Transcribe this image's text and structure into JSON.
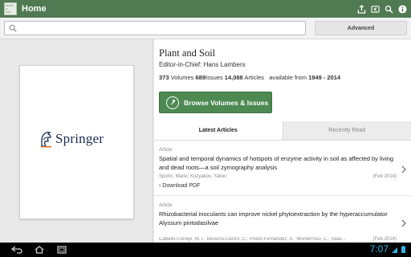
{
  "app": {
    "icon_lines": [
      "PLANT",
      "&",
      "SOIL"
    ],
    "title": "Home",
    "actions": [
      "share-icon",
      "back-icon",
      "search-icon",
      "info-icon"
    ]
  },
  "search": {
    "value": "",
    "placeholder": "",
    "advanced_label": "Advanced"
  },
  "cover": {
    "publisher": "Springer"
  },
  "journal": {
    "title": "Plant and Soil",
    "editor_label": "Editor-in-Chief:",
    "editor_name": "Hans Lambers",
    "volumes_count": "373",
    "volumes_label": "Volumes",
    "issues_count": "689",
    "issues_label": "Issues",
    "articles_count": "14,088",
    "articles_label": "Articles",
    "available_label": "available from",
    "year_range": "1949 - 2014",
    "browse_label": "Browse Volumes & Issues"
  },
  "tabs": [
    {
      "label": "Latest Articles",
      "active": true
    },
    {
      "label": "Recently Read",
      "active": false
    }
  ],
  "articles": [
    {
      "type": "Article",
      "title": "Spatial and temporal dynamics of hotspots of enzyme activity in soil as affected by living and dead roots—a soil zymography analysis",
      "authors": "Spohn, Marie; Kuzyakov, Yakov",
      "date": "(Feb 2014)",
      "pdf_label": "› Download PDF"
    },
    {
      "type": "Article",
      "title": "Rhizobacterial inoculants can improve nickel phytoextraction by the hyperaccumulator Alyssum pintodasilvae",
      "authors": "Cabello-Conejo, M. I.; Becerra-Castro, C.; Prieto-Fernández, A.; Monterroso, C.; Saav...",
      "date": "(Feb 2014)"
    }
  ],
  "system": {
    "time": "7:07",
    "nav": [
      "back-nav-icon",
      "home-nav-icon",
      "recents-nav-icon"
    ]
  },
  "colors": {
    "action_bar": "#4f7a52",
    "button_green": "#4d8a52",
    "clock": "#33b5e5"
  }
}
